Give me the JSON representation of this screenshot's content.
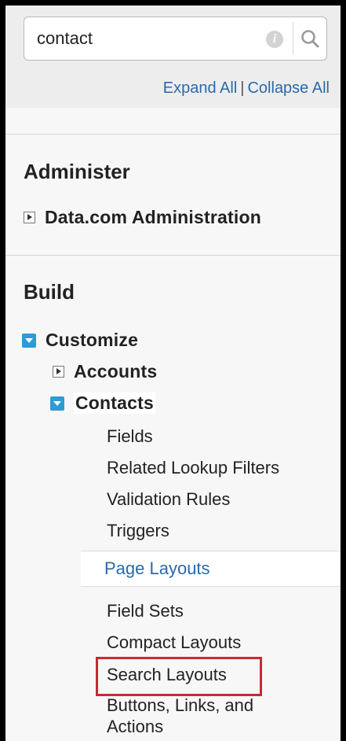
{
  "search": {
    "value": "contact",
    "placeholder": ""
  },
  "actions": {
    "expand_all": "Expand All",
    "separator": "|",
    "collapse_all": "Collapse All"
  },
  "administer": {
    "title": "Administer",
    "items": [
      {
        "label": "Data.com Administration",
        "state": "collapsed"
      }
    ]
  },
  "build": {
    "title": "Build",
    "customize": {
      "label": "Customize",
      "state": "expanded",
      "accounts": {
        "label": "Accounts",
        "state": "collapsed"
      },
      "contacts": {
        "label": "Contacts",
        "state": "expanded",
        "items": [
          "Fields",
          "Related Lookup Filters",
          "Validation Rules",
          "Triggers",
          "Page Layouts",
          "Field Sets",
          "Compact Layouts",
          "Search Layouts",
          "Buttons, Links, and",
          "Actions"
        ]
      }
    }
  },
  "colors": {
    "link": "#2a6aa8",
    "expand_toggle": "#2d9bd6",
    "highlight": "#c62a35"
  },
  "icons": [
    "info-icon",
    "search-icon",
    "expand-toggle-icon",
    "collapse-toggle-icon"
  ]
}
